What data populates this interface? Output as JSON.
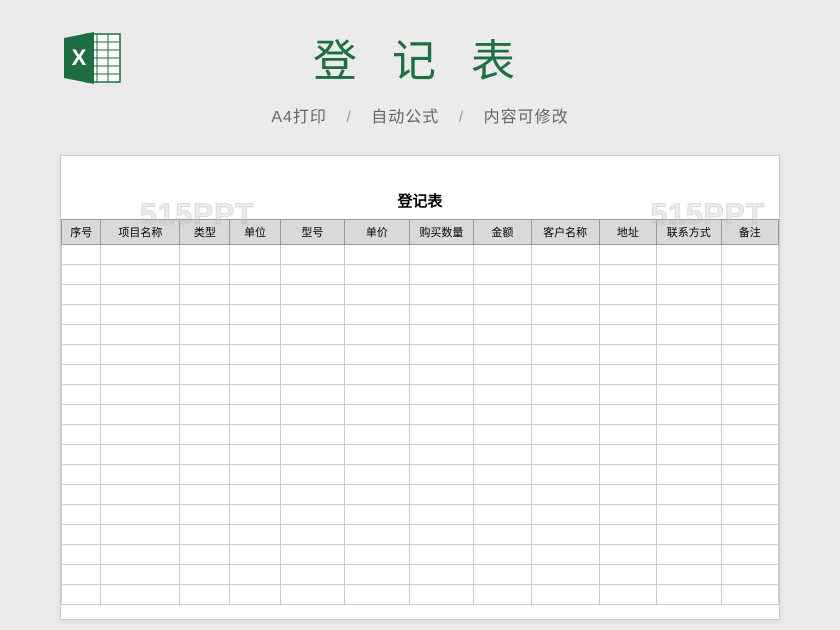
{
  "header": {
    "title": "登 记 表",
    "subtitle_parts": [
      "A4打印",
      "自动公式",
      "内容可修改"
    ],
    "separator": "/"
  },
  "sheet": {
    "title": "登记表",
    "columns": [
      "序号",
      "项目名称",
      "类型",
      "单位",
      "型号",
      "单价",
      "购买数量",
      "金额",
      "客户名称",
      "地址",
      "联系方式",
      "备注"
    ],
    "row_count": 18
  },
  "watermark": "515PPT",
  "icon": {
    "name": "excel-icon",
    "letter": "X"
  }
}
